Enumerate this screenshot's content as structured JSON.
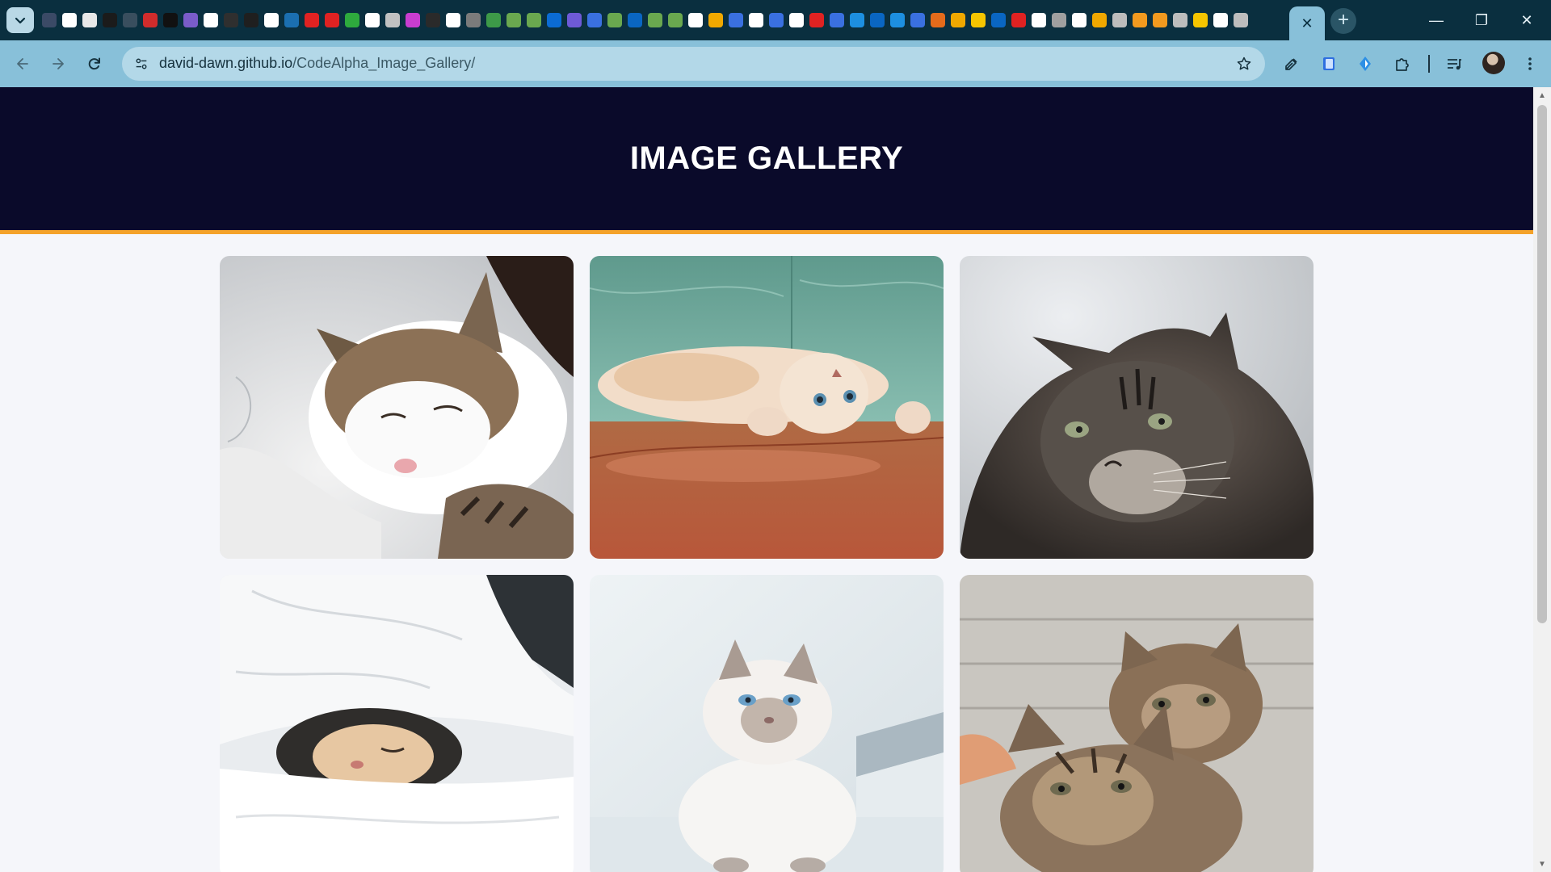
{
  "browser": {
    "url_host": "david-dawn.github.io",
    "url_path": "/CodeAlpha_Image_Gallery/",
    "active_tab_close": "✕",
    "new_tab": "+",
    "window_controls": {
      "minimize": "—",
      "restore": "❐",
      "close": "✕"
    },
    "favicon_colors": [
      "#3b4a66",
      "#ffffff",
      "#e8e8e8",
      "#1b1b1b",
      "#394e5e",
      "#d12c2c",
      "#111111",
      "#7a5cc9",
      "#ffffff",
      "#2f2f2f",
      "#1f1f1f",
      "#ffffff",
      "#1b6fb0",
      "#e02222",
      "#e02222",
      "#2eaa3d",
      "#ffffff",
      "#c1c1c1",
      "#c83dd0",
      "#2a2a2a",
      "#ffffff",
      "#7b7b7b",
      "#3d9948",
      "#6aa84f",
      "#6aa84f",
      "#0b6bd3",
      "#6e5ad6",
      "#3a70e0",
      "#6aa84f",
      "#0a66c2",
      "#6aa84f",
      "#6aa84f",
      "#ffffff",
      "#f0a800",
      "#3a70e0",
      "#ffffff",
      "#3a70e0",
      "#ffffff",
      "#e02222",
      "#3a70e0",
      "#1d8fe0",
      "#0a66c2",
      "#1d8fe0",
      "#3a70e0",
      "#e46b1b",
      "#f0a800",
      "#f6c500",
      "#0a66c2",
      "#e02222",
      "#ffffff",
      "#a0a0a0",
      "#ffffff",
      "#f0a800",
      "#bdbdbd",
      "#f29a1f",
      "#f29a1f",
      "#bdbdbd",
      "#f6c500",
      "#ffffff",
      "#bdbdbd"
    ]
  },
  "page": {
    "title": "IMAGE GALLERY",
    "accent_color": "#f4a22a",
    "header_bg": "#0a0a2a"
  },
  "gallery": {
    "images": [
      {
        "subject": "cat-sleeping-on-white-bedding"
      },
      {
        "subject": "kitten-lying-upside-down-on-wood-floor"
      },
      {
        "subject": "tabby-cat-portrait"
      },
      {
        "subject": "kitten-under-white-duvet"
      },
      {
        "subject": "white-fluffy-kitten"
      },
      {
        "subject": "two-tabby-kittens"
      }
    ]
  }
}
